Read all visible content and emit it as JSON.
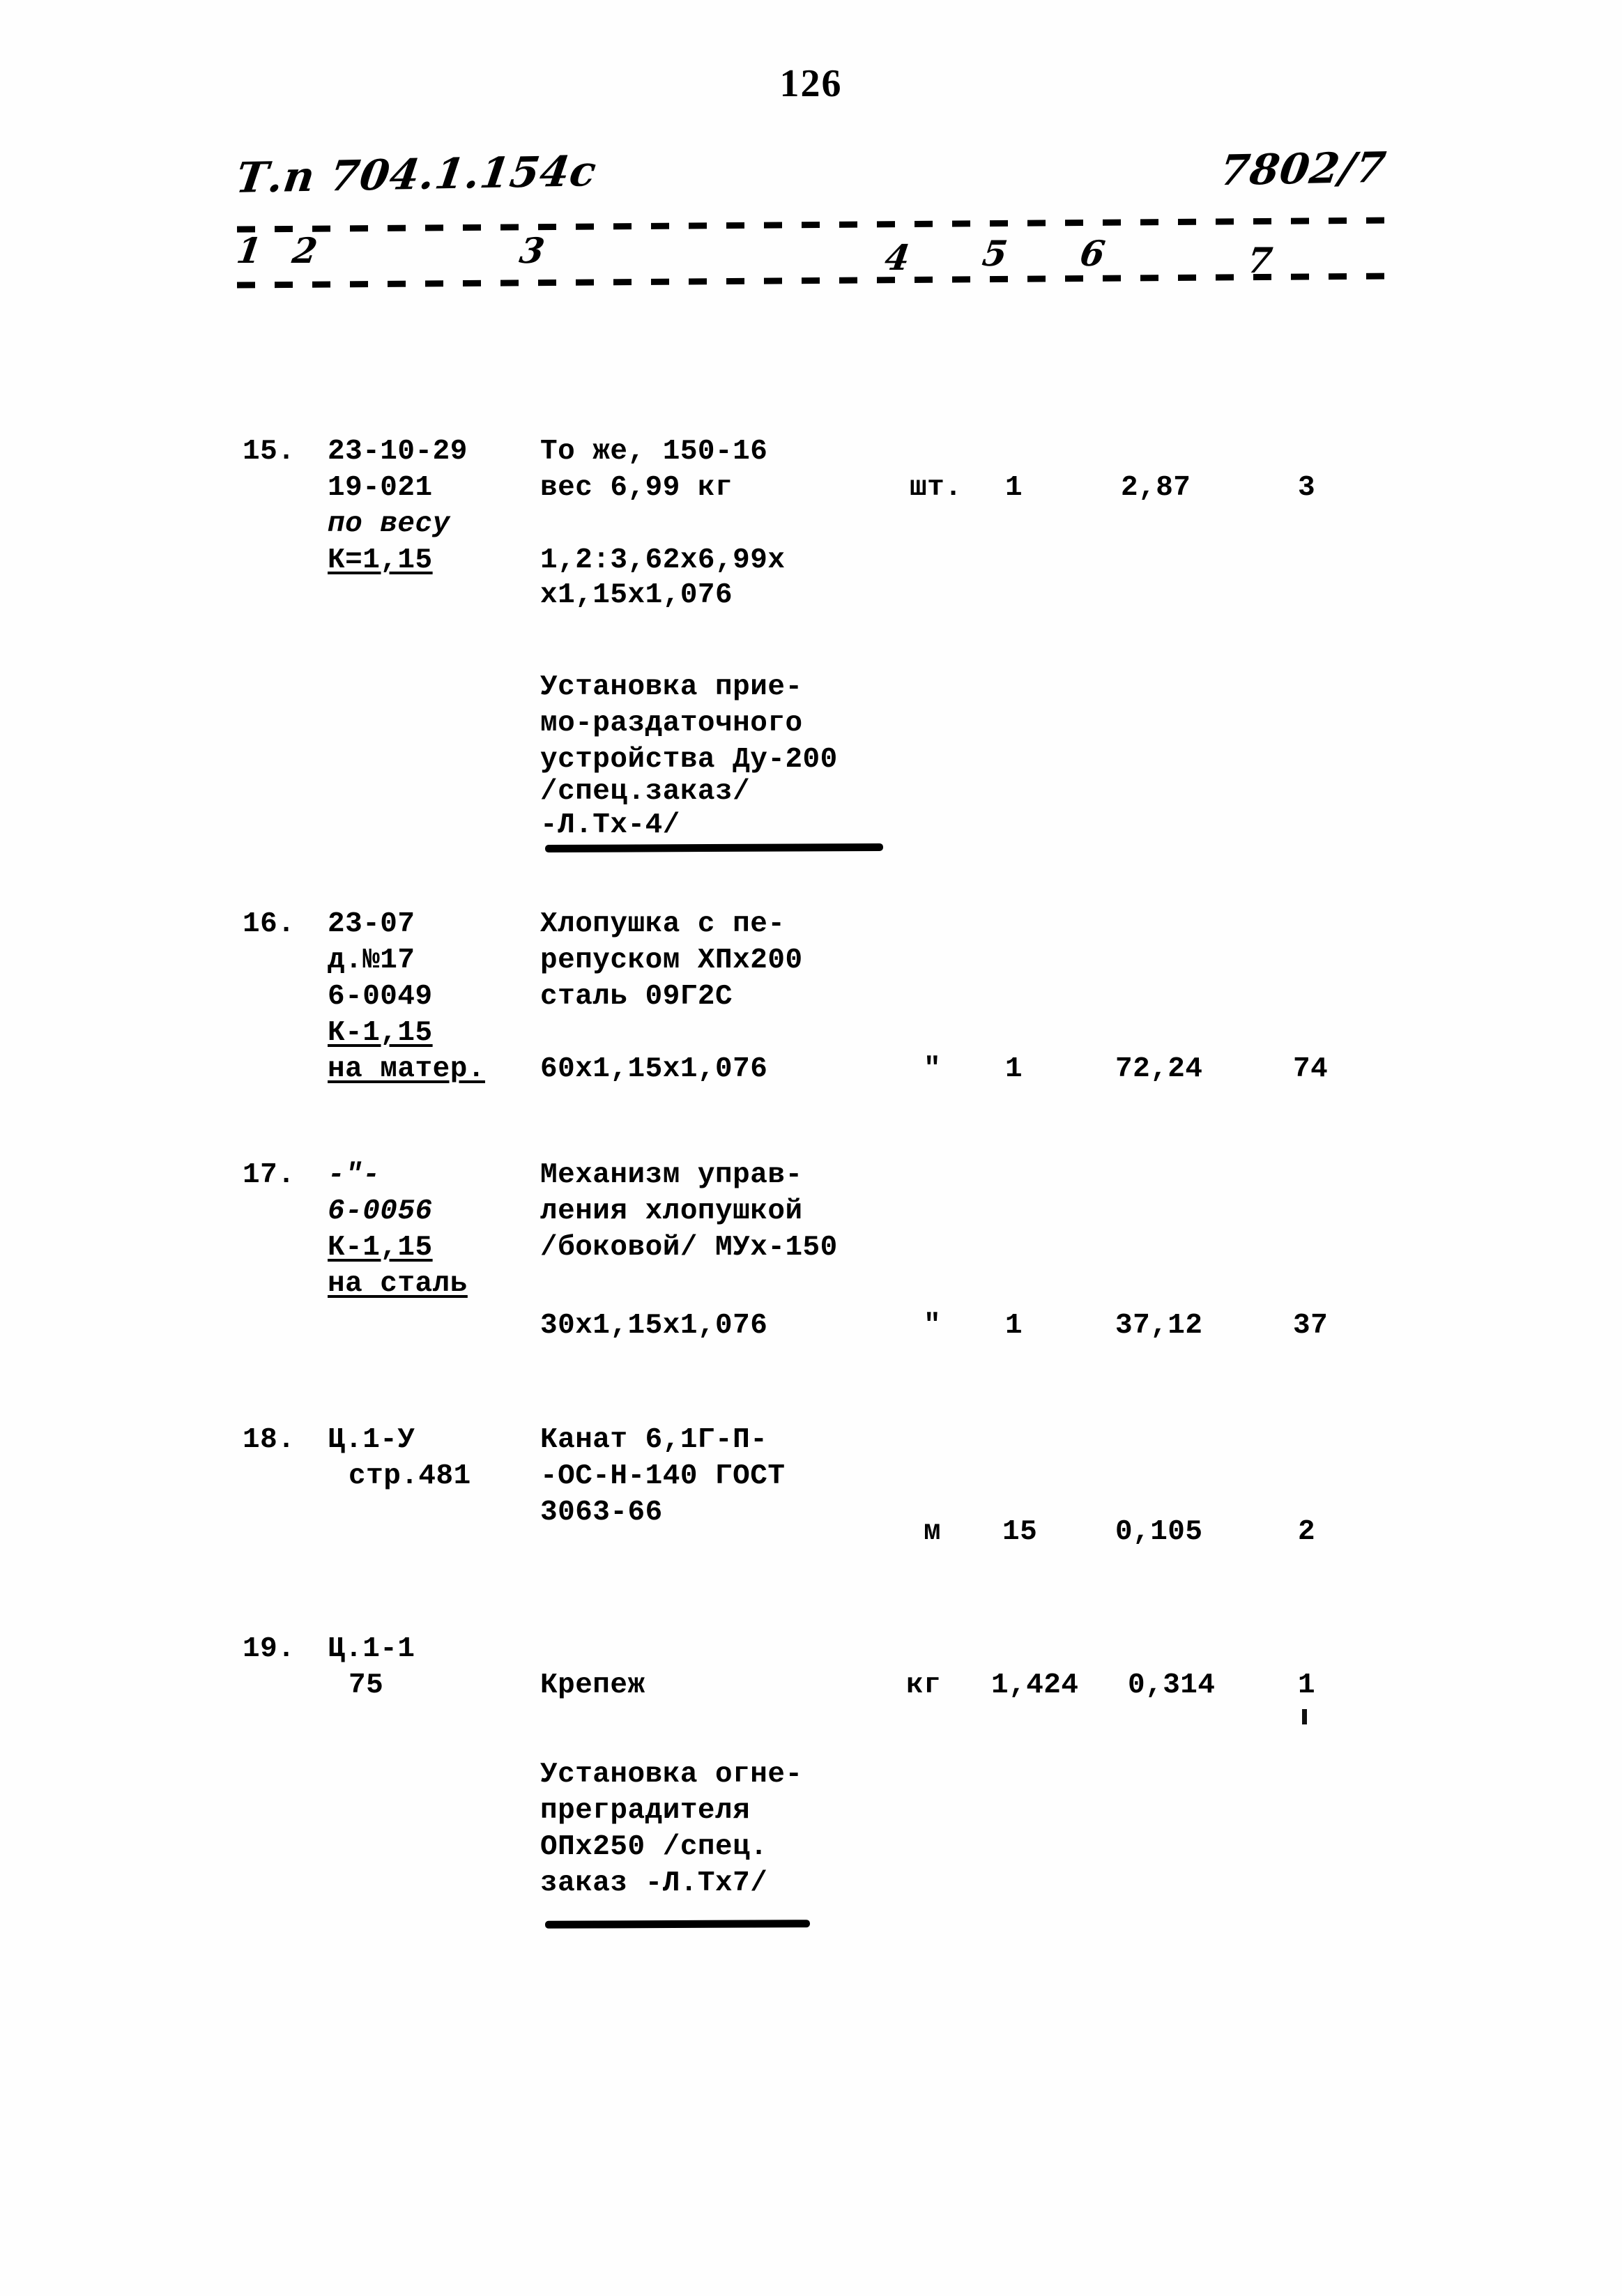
{
  "document": {
    "page_number": "126",
    "header": {
      "left_handwritten": "Т.п 704.1.154с",
      "right_handwritten": "7802/7"
    },
    "column_numbers": [
      "1",
      "2",
      "3",
      "4",
      "5",
      "6",
      "7"
    ]
  },
  "rows": [
    {
      "id": "row-15",
      "num": "15.",
      "code_lines": [
        "23-10-29",
        "19-021",
        "по весу",
        "К=1,15"
      ],
      "desc_lines": [
        "То же, 150-16",
        "вес 6,99 кг",
        "1,2:3,62х6,99х",
        "х1,15х1,076"
      ],
      "unit": "шт.",
      "qty": "1",
      "price": "2,87",
      "total": "3"
    },
    {
      "id": "row-16",
      "num": "16.",
      "code_lines": [
        "23-07",
        "д.№17",
        "6-0049",
        "К-1,15",
        "на матер."
      ],
      "desc_lines": [
        "Хлопушка с пе-",
        "репуском ХПх200",
        "сталь 09Г2С",
        "60х1,15х1,076"
      ],
      "unit": "\"",
      "qty": "1",
      "price": "72,24",
      "total": "74"
    },
    {
      "id": "row-17",
      "num": "17.",
      "code_lines": [
        "-\"-",
        "6-0056",
        "К-1,15",
        "на сталь"
      ],
      "desc_lines": [
        "Механизм управ-",
        "ления хлопушкой",
        "/боковой/ МУх-150",
        "30х1,15х1,076"
      ],
      "unit": "\"",
      "qty": "1",
      "price": "37,12",
      "total": "37"
    },
    {
      "id": "row-18",
      "num": "18.",
      "code_lines": [
        "Ц.1-У",
        "стр.481"
      ],
      "desc_lines": [
        "Канат 6,1Г-П-",
        "-ОС-Н-140 ГОСТ",
        "3063-66"
      ],
      "unit": "м",
      "qty": "15",
      "price": "0,105",
      "total": "2"
    },
    {
      "id": "row-19",
      "num": "19.",
      "code_lines": [
        "Ц.1-1",
        "75"
      ],
      "desc_lines": [
        "Крепеж"
      ],
      "unit": "кг",
      "qty": "1,424",
      "price": "0,314",
      "total": "1"
    }
  ],
  "section_titles": [
    {
      "id": "section-title-1",
      "lines": [
        "Установка прие-",
        "мо-раздаточного",
        "устройства Ду-200",
        "/спец.заказ/",
        "-Л.Тх-4/"
      ]
    },
    {
      "id": "section-title-2",
      "lines": [
        "Установка огне-",
        "преградителя",
        "ОПх250 /спец.",
        "заказ -Л.Тх7/"
      ]
    }
  ]
}
